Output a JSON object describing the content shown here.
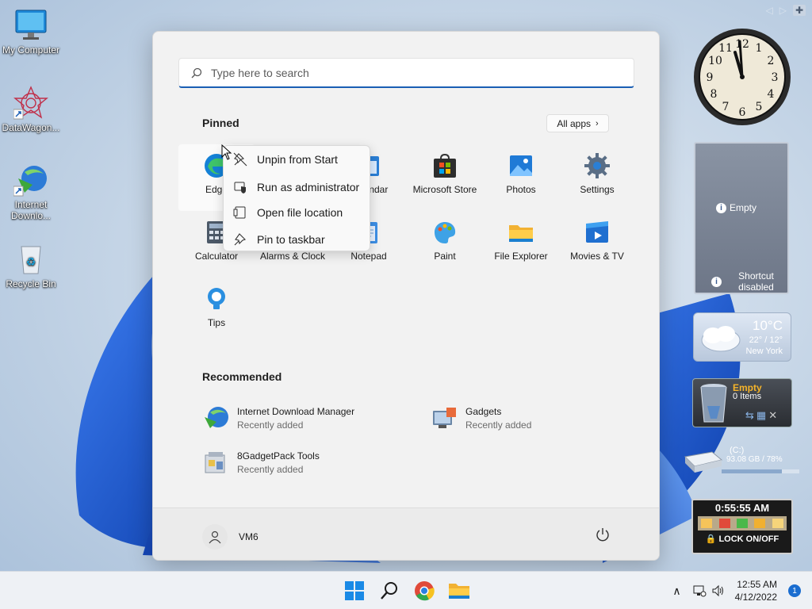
{
  "desktop": {
    "icons": [
      {
        "label": "My Computer"
      },
      {
        "label": "DataWagon..."
      },
      {
        "label": "Internet Downlo..."
      },
      {
        "label": "Recycle Bin"
      }
    ]
  },
  "start": {
    "search_placeholder": "Type here to search",
    "pinned_title": "Pinned",
    "all_apps_label": "All apps",
    "pinned": [
      {
        "label": "Edge",
        "icon": "edge-icon"
      },
      {
        "label": "Calendar",
        "icon": "calendar-icon"
      },
      {
        "label": "Microsoft Store",
        "icon": "store-icon"
      },
      {
        "label": "Photos",
        "icon": "photos-icon"
      },
      {
        "label": "Settings",
        "icon": "gear-icon"
      },
      {
        "label": "Calculator",
        "icon": "calculator-icon"
      },
      {
        "label": "Alarms & Clock",
        "icon": "alarm-icon"
      },
      {
        "label": "Notepad",
        "icon": "notepad-icon"
      },
      {
        "label": "Paint",
        "icon": "paint-icon"
      },
      {
        "label": "File Explorer",
        "icon": "folder-icon"
      },
      {
        "label": "Movies & TV",
        "icon": "movies-icon"
      },
      {
        "label": "Tips",
        "icon": "tips-icon"
      }
    ],
    "recommended_title": "Recommended",
    "recommended": [
      {
        "name": "Internet Download Manager",
        "sub": "Recently added"
      },
      {
        "name": "Gadgets",
        "sub": "Recently added"
      },
      {
        "name": "8GadgetPack Tools",
        "sub": "Recently added"
      }
    ],
    "user_name": "VM6"
  },
  "context_menu": [
    {
      "label": "Unpin from Start",
      "icon": "unpin-icon"
    },
    {
      "label": "Run as administrator",
      "icon": "shield-icon"
    },
    {
      "label": "Open file location",
      "icon": "folder-open-icon"
    },
    {
      "label": "Pin to taskbar",
      "icon": "pin-icon"
    }
  ],
  "gadgets": {
    "clock_time": "11:58",
    "slideshow": {
      "empty": "Empty",
      "shortcut": "Shortcut disabled"
    },
    "weather": {
      "temp": "10°C",
      "range": "22° / 12°",
      "city": "New York"
    },
    "recycle": {
      "status": "Empty",
      "items": "0 Items"
    },
    "drive": {
      "label": "(C:)",
      "usage": "93.08 GB / 78%",
      "fill": 0.78
    },
    "lock": {
      "time": "0:55:55 AM",
      "label": "LOCK ON/OFF"
    }
  },
  "taskbar": {
    "time": "12:55 AM",
    "date": "4/12/2022",
    "notifications": "1"
  },
  "colors": {
    "accent": "#1a5fb4",
    "start_bg": "#f2f2f2",
    "taskbar_bg": "#eef1f5"
  }
}
